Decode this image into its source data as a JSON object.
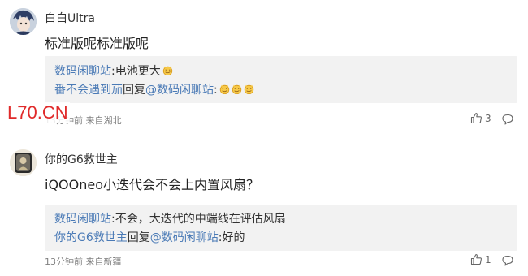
{
  "comments": [
    {
      "username": "白白Ultra",
      "text": "标准版呢标准版呢",
      "replies": [
        {
          "author": "数码闲聊站",
          "sep": ":",
          "content": "电池更大"
        },
        {
          "author": "番不会遇到茄",
          "action": "回复",
          "target": "@数码闲聊站",
          "sep": ":"
        }
      ],
      "meta": "13分钟前 来自湖北",
      "likes": "3"
    },
    {
      "username": "你的G6救世主",
      "text": "iQOOneo小迭代会不会上内置风扇？",
      "replies": [
        {
          "author": "数码闲聊站",
          "sep": ":",
          "content": "不会，大迭代的中端线在评估风扇"
        },
        {
          "author": "你的G6救世主",
          "action": "回复",
          "target": "@数码闲聊站",
          "sep": ":",
          "content": "好的"
        }
      ],
      "meta": "13分钟前 来自新疆",
      "likes": "1"
    }
  ],
  "watermark": "L70.CN",
  "colors": {
    "link": "#4a7ab6",
    "watermark": "#e02a2a",
    "reply_bg": "#f2f2f2"
  },
  "icons": [
    "thumbs-up-icon",
    "reply-bubble-icon",
    "smirk-emoji-icon"
  ]
}
